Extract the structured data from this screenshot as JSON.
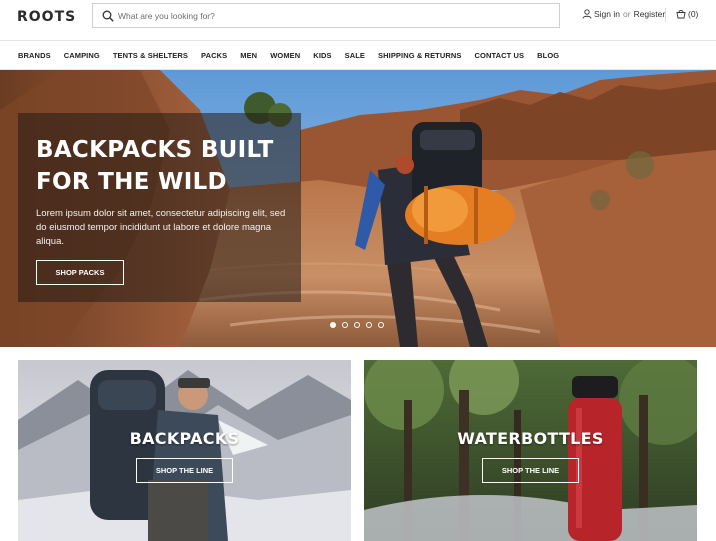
{
  "header": {
    "logo": "ROOTS",
    "search_placeholder": "What are you looking for?",
    "sign_in": "Sign in",
    "or": "or",
    "register": "Register",
    "cart_count": "(0)"
  },
  "nav": {
    "items": [
      "BRANDS",
      "CAMPING",
      "TENTS & SHELTERS",
      "PACKS",
      "MEN",
      "WOMEN",
      "KIDS",
      "SALE",
      "SHIPPING & RETURNS",
      "CONTACT US",
      "BLOG"
    ]
  },
  "hero": {
    "title": "BACKPACKS BUILT FOR THE WILD",
    "text": "Lorem ipsum dolor sit amet, consectetur adipiscing elit, sed do eiusmod tempor incididunt ut labore et dolore magna aliqua.",
    "button": "SHOP PACKS",
    "slides": 5,
    "active_slide": 1
  },
  "tiles": [
    {
      "title": "BACKPACKS",
      "button": "SHOP THE LINE"
    },
    {
      "title": "WATERBOTTLES",
      "button": "SHOP THE LINE"
    }
  ],
  "colors": {
    "text": "#222222",
    "border": "#cfcfcf",
    "hero_panel": "#261c16"
  }
}
